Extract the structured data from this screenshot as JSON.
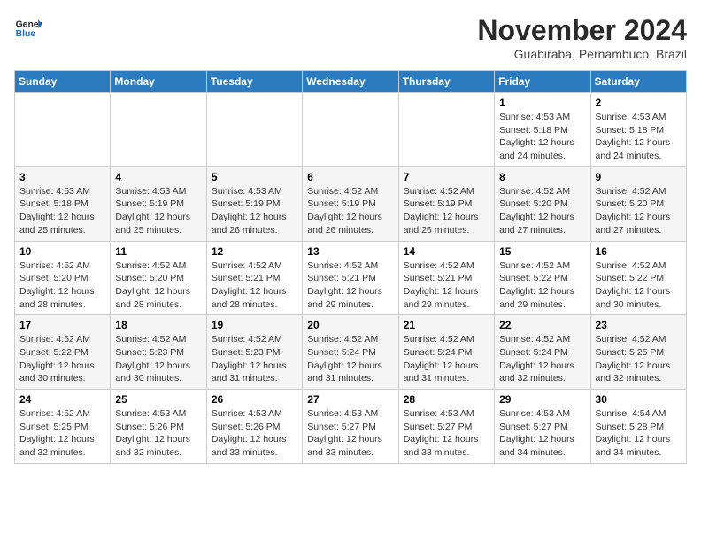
{
  "header": {
    "logo_line1": "General",
    "logo_line2": "Blue",
    "month_title": "November 2024",
    "location": "Guabiraba, Pernambuco, Brazil"
  },
  "weekdays": [
    "Sunday",
    "Monday",
    "Tuesday",
    "Wednesday",
    "Thursday",
    "Friday",
    "Saturday"
  ],
  "weeks": [
    [
      {
        "day": "",
        "info": ""
      },
      {
        "day": "",
        "info": ""
      },
      {
        "day": "",
        "info": ""
      },
      {
        "day": "",
        "info": ""
      },
      {
        "day": "",
        "info": ""
      },
      {
        "day": "1",
        "info": "Sunrise: 4:53 AM\nSunset: 5:18 PM\nDaylight: 12 hours and 24 minutes."
      },
      {
        "day": "2",
        "info": "Sunrise: 4:53 AM\nSunset: 5:18 PM\nDaylight: 12 hours and 24 minutes."
      }
    ],
    [
      {
        "day": "3",
        "info": "Sunrise: 4:53 AM\nSunset: 5:18 PM\nDaylight: 12 hours and 25 minutes."
      },
      {
        "day": "4",
        "info": "Sunrise: 4:53 AM\nSunset: 5:19 PM\nDaylight: 12 hours and 25 minutes."
      },
      {
        "day": "5",
        "info": "Sunrise: 4:53 AM\nSunset: 5:19 PM\nDaylight: 12 hours and 26 minutes."
      },
      {
        "day": "6",
        "info": "Sunrise: 4:52 AM\nSunset: 5:19 PM\nDaylight: 12 hours and 26 minutes."
      },
      {
        "day": "7",
        "info": "Sunrise: 4:52 AM\nSunset: 5:19 PM\nDaylight: 12 hours and 26 minutes."
      },
      {
        "day": "8",
        "info": "Sunrise: 4:52 AM\nSunset: 5:20 PM\nDaylight: 12 hours and 27 minutes."
      },
      {
        "day": "9",
        "info": "Sunrise: 4:52 AM\nSunset: 5:20 PM\nDaylight: 12 hours and 27 minutes."
      }
    ],
    [
      {
        "day": "10",
        "info": "Sunrise: 4:52 AM\nSunset: 5:20 PM\nDaylight: 12 hours and 28 minutes."
      },
      {
        "day": "11",
        "info": "Sunrise: 4:52 AM\nSunset: 5:20 PM\nDaylight: 12 hours and 28 minutes."
      },
      {
        "day": "12",
        "info": "Sunrise: 4:52 AM\nSunset: 5:21 PM\nDaylight: 12 hours and 28 minutes."
      },
      {
        "day": "13",
        "info": "Sunrise: 4:52 AM\nSunset: 5:21 PM\nDaylight: 12 hours and 29 minutes."
      },
      {
        "day": "14",
        "info": "Sunrise: 4:52 AM\nSunset: 5:21 PM\nDaylight: 12 hours and 29 minutes."
      },
      {
        "day": "15",
        "info": "Sunrise: 4:52 AM\nSunset: 5:22 PM\nDaylight: 12 hours and 29 minutes."
      },
      {
        "day": "16",
        "info": "Sunrise: 4:52 AM\nSunset: 5:22 PM\nDaylight: 12 hours and 30 minutes."
      }
    ],
    [
      {
        "day": "17",
        "info": "Sunrise: 4:52 AM\nSunset: 5:22 PM\nDaylight: 12 hours and 30 minutes."
      },
      {
        "day": "18",
        "info": "Sunrise: 4:52 AM\nSunset: 5:23 PM\nDaylight: 12 hours and 30 minutes."
      },
      {
        "day": "19",
        "info": "Sunrise: 4:52 AM\nSunset: 5:23 PM\nDaylight: 12 hours and 31 minutes."
      },
      {
        "day": "20",
        "info": "Sunrise: 4:52 AM\nSunset: 5:24 PM\nDaylight: 12 hours and 31 minutes."
      },
      {
        "day": "21",
        "info": "Sunrise: 4:52 AM\nSunset: 5:24 PM\nDaylight: 12 hours and 31 minutes."
      },
      {
        "day": "22",
        "info": "Sunrise: 4:52 AM\nSunset: 5:24 PM\nDaylight: 12 hours and 32 minutes."
      },
      {
        "day": "23",
        "info": "Sunrise: 4:52 AM\nSunset: 5:25 PM\nDaylight: 12 hours and 32 minutes."
      }
    ],
    [
      {
        "day": "24",
        "info": "Sunrise: 4:52 AM\nSunset: 5:25 PM\nDaylight: 12 hours and 32 minutes."
      },
      {
        "day": "25",
        "info": "Sunrise: 4:53 AM\nSunset: 5:26 PM\nDaylight: 12 hours and 32 minutes."
      },
      {
        "day": "26",
        "info": "Sunrise: 4:53 AM\nSunset: 5:26 PM\nDaylight: 12 hours and 33 minutes."
      },
      {
        "day": "27",
        "info": "Sunrise: 4:53 AM\nSunset: 5:27 PM\nDaylight: 12 hours and 33 minutes."
      },
      {
        "day": "28",
        "info": "Sunrise: 4:53 AM\nSunset: 5:27 PM\nDaylight: 12 hours and 33 minutes."
      },
      {
        "day": "29",
        "info": "Sunrise: 4:53 AM\nSunset: 5:27 PM\nDaylight: 12 hours and 34 minutes."
      },
      {
        "day": "30",
        "info": "Sunrise: 4:54 AM\nSunset: 5:28 PM\nDaylight: 12 hours and 34 minutes."
      }
    ]
  ]
}
